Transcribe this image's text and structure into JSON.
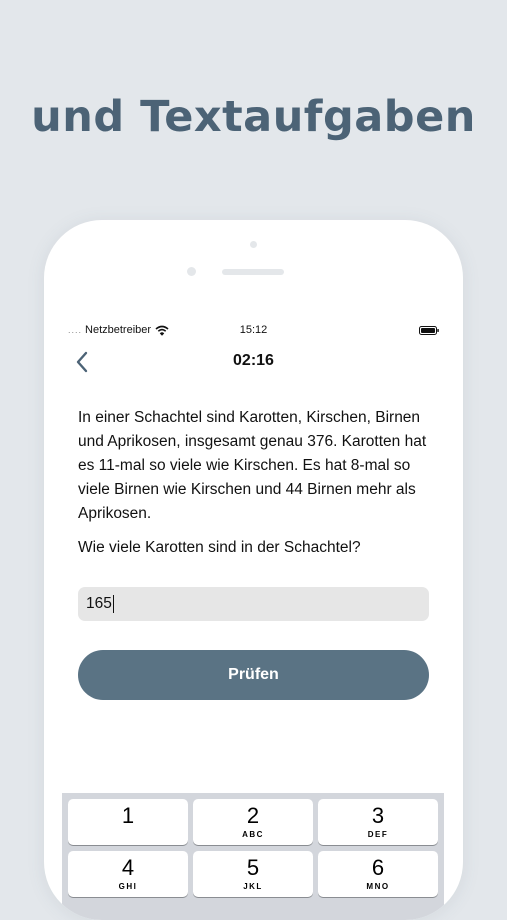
{
  "headline": "und Textaufgaben",
  "statusbar": {
    "signal": "....",
    "carrier": "Netzbetreiber",
    "time": "15:12"
  },
  "navbar": {
    "timer": "02:16"
  },
  "question": {
    "text": "In einer Schachtel sind Karotten, Kirschen, Birnen und Aprikosen, insgesamt genau 376. Karotten hat es 11-mal so viele wie Kirschen. Es hat 8-mal so viele Birnen wie Kirschen und 44 Birnen mehr als Aprikosen.",
    "prompt": "Wie viele Karotten sind in der Schachtel?"
  },
  "answer": {
    "value": "165"
  },
  "check_button_label": "Prüfen",
  "keypad": {
    "keys": [
      {
        "digit": "1",
        "letters": ""
      },
      {
        "digit": "2",
        "letters": "ABC"
      },
      {
        "digit": "3",
        "letters": "DEF"
      },
      {
        "digit": "4",
        "letters": "GHI"
      },
      {
        "digit": "5",
        "letters": "JKL"
      },
      {
        "digit": "6",
        "letters": "MNO"
      }
    ]
  },
  "colors": {
    "accent": "#5a7384",
    "headline": "#4c6376",
    "background": "#e3e7eb"
  }
}
